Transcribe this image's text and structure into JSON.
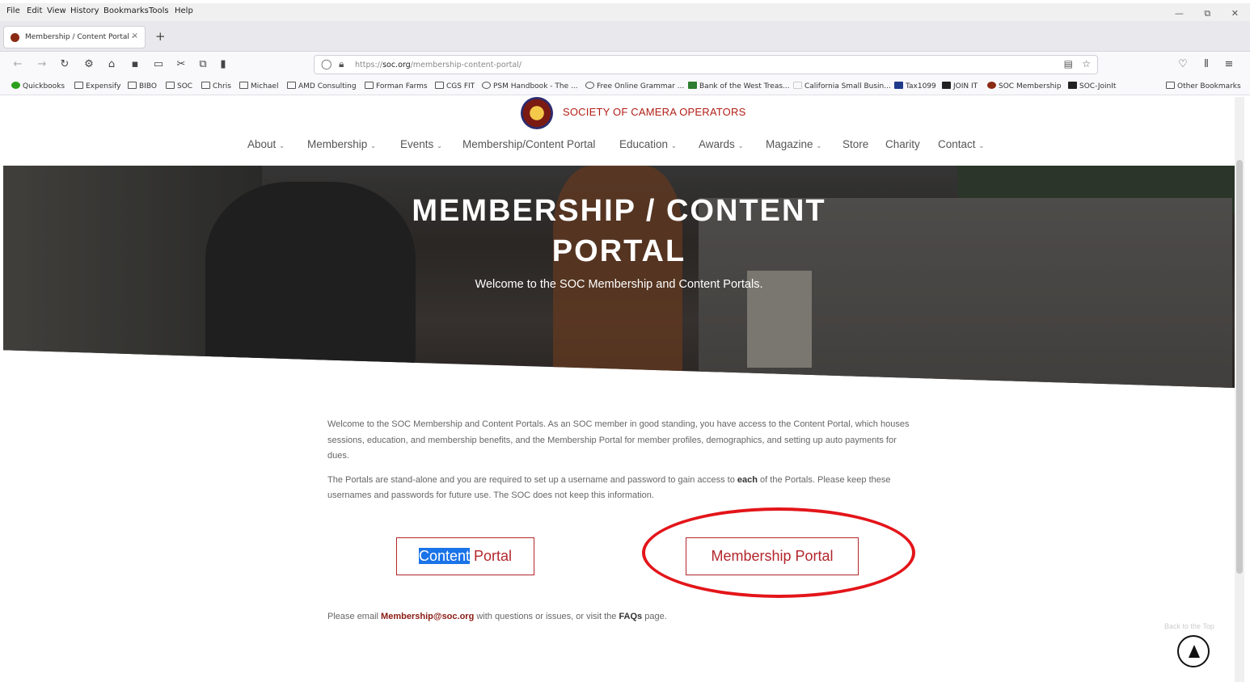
{
  "menubar": {
    "items": [
      "File",
      "Edit",
      "View",
      "History",
      "Bookmarks",
      "Tools",
      "Help"
    ],
    "controls": [
      "—",
      "⧉",
      "✕"
    ]
  },
  "tab": {
    "title": "Membership / Content Portal -",
    "close": "×",
    "new": "+"
  },
  "toolbar": {
    "url_prefix": "https://",
    "url_domain": "soc.org",
    "url_path": "/membership-content-portal/"
  },
  "bookmarks": [
    "Quickbooks",
    "Expensify",
    "BIBO",
    "SOC",
    "Chris",
    "Michael",
    "AMD Consulting",
    "Forman Farms",
    "CGS FIT",
    "PSM Handbook - The ...",
    "Free Online Grammar ...",
    "Bank of the West Treas...",
    "California Small Busin...",
    "Tax1099",
    "JOIN IT",
    "SOC Membership",
    "SOC-JoinIt"
  ],
  "other_bookmarks": "Other Bookmarks",
  "site": {
    "logo_text": "SOCIETY OF CAMERA OPERATORS"
  },
  "nav": [
    "About",
    "Membership",
    "Events",
    "Membership/Content Portal",
    "Education",
    "Awards",
    "Magazine",
    "Store",
    "Charity",
    "Contact"
  ],
  "hero": {
    "title_line1": "MEMBERSHIP / CONTENT",
    "title_line2": "PORTAL",
    "subtitle": "Welcome to the SOC Membership and Content Portals."
  },
  "intro": {
    "p1": "Welcome to the SOC Membership and Content Portals. As an SOC member in good standing, you have access to the Content Portal, which houses sessions, education, and membership benefits, and the Membership Portal for member profiles, demographics, and setting up auto payments for dues.",
    "p2_a": "The Portals are stand-alone and you are required to set up a username and password to gain access to ",
    "p2_bold": "each",
    "p2_b": " of the Portals. Please keep these usernames and passwords for future use. The SOC does not keep this information."
  },
  "buttons": {
    "content_sel": "Content",
    "content_rest": " Portal",
    "membership": "Membership Portal"
  },
  "footer": {
    "a": "Please email ",
    "email": "Membership@soc.org",
    "b": " with questions or issues, or visit the ",
    "faq": "FAQs",
    "c": " page."
  },
  "back_to_top": "Back to the Top",
  "colors": {
    "accent": "#b3262b",
    "annotation": "#e3151a"
  }
}
